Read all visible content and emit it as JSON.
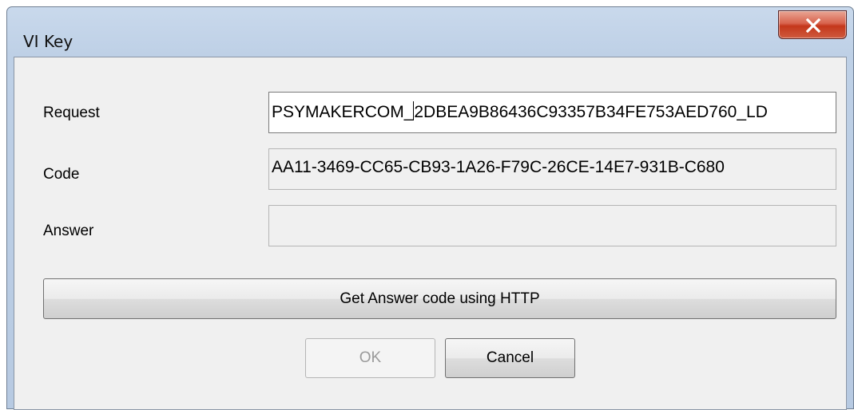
{
  "window": {
    "title": "VI Key",
    "close_glyph": "X"
  },
  "form": {
    "request": {
      "label": "Request",
      "value_before_caret": "PSYMAKERCOM_",
      "value_after_caret": "2DBEA9B86436C93357B34FE753AED760_LD"
    },
    "code": {
      "label": "Code",
      "value": "AA11-3469-CC65-CB93-1A26-F79C-26CE-14E7-931B-C680"
    },
    "answer": {
      "label": "Answer",
      "value": ""
    }
  },
  "buttons": {
    "http_label": "Get Answer code using HTTP",
    "ok_label": "OK",
    "cancel_label": "Cancel"
  },
  "icons": {
    "close": "close-icon"
  },
  "colors": {
    "title_bar": "#bed0e6",
    "close_button": "#c4371b",
    "dialog_bg": "#f0f0f0"
  }
}
